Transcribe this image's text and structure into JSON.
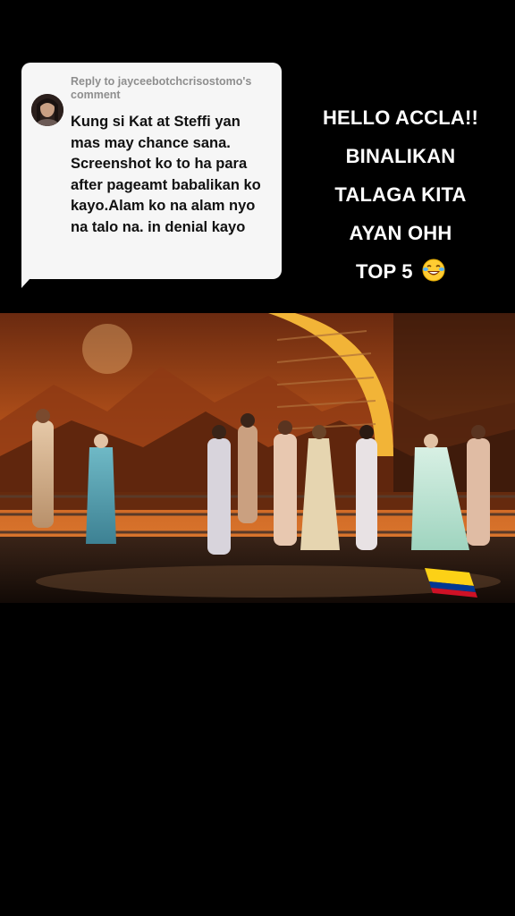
{
  "reply": {
    "header": "Reply to jayceebotchcrisostomo's comment",
    "comment": "Kung si Kat at Steffi yan mas may chance sana. Screenshot ko to ha para after pageamt babalikan ko kayo.Alam ko na alam nyo na talo na. in denial kayo"
  },
  "overlay": {
    "line1": "HELLO ACCLA!!",
    "line2": "BINALIKAN",
    "line3": "TALAGA KITA",
    "line4": "AYAN OHH",
    "line5": "TOP 5",
    "emoji_icon": "laughing-crying-face-icon"
  },
  "video": {
    "scene": "pageant-stage-contestants"
  },
  "colors": {
    "background": "#000000",
    "card": "#f6f6f6",
    "header_text": "#8e8e8e",
    "comment_text": "#111111",
    "overlay_text": "#ffffff"
  }
}
